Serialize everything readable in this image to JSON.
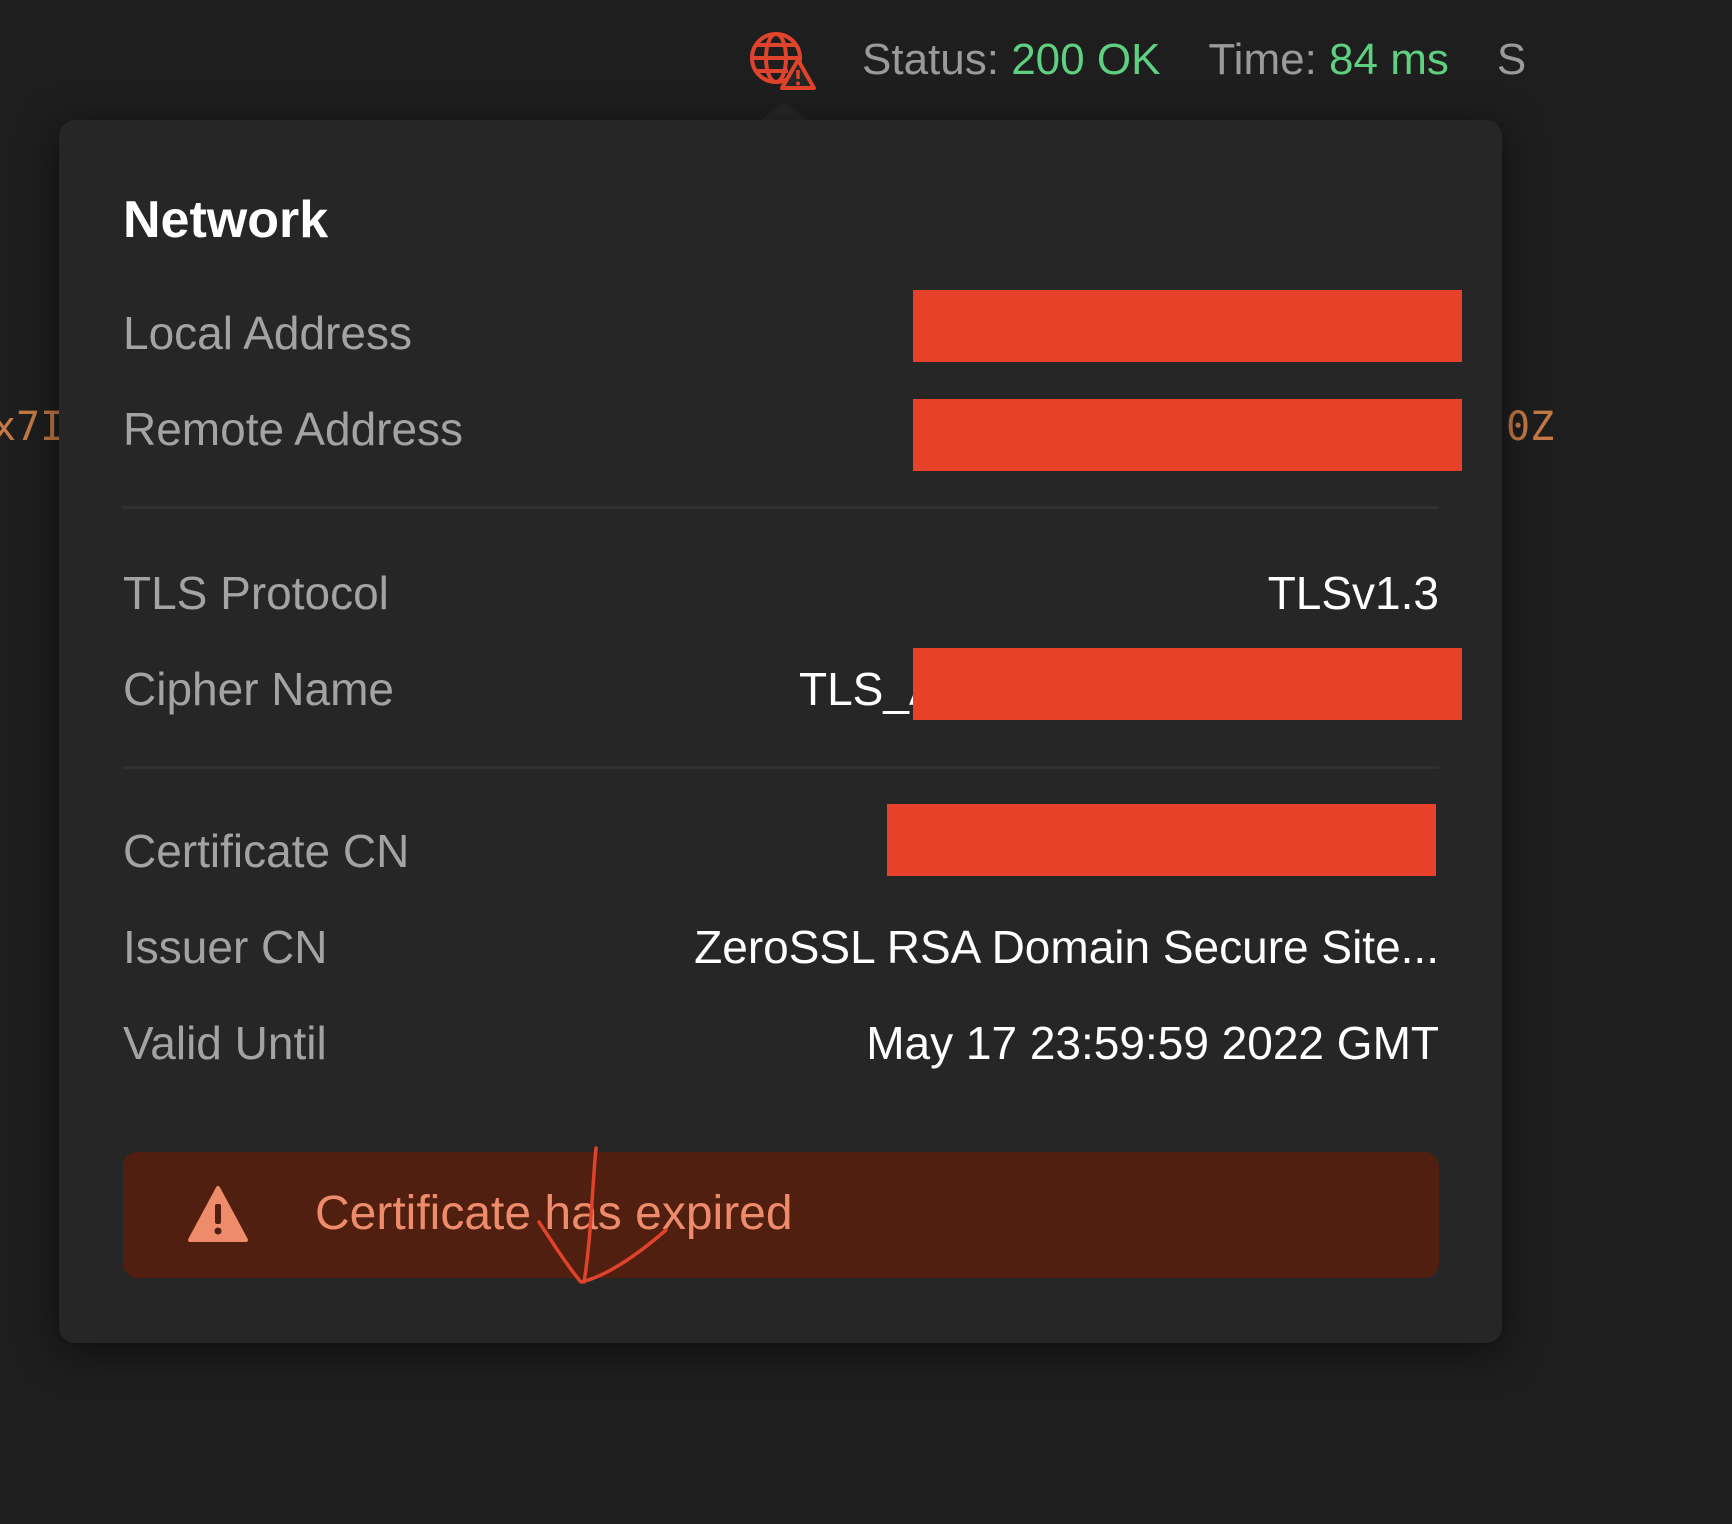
{
  "status_bar": {
    "status_label": "Status:",
    "status_value": "200 OK",
    "time_label": "Time:",
    "time_value": "84 ms",
    "truncated_label": "S",
    "ok_color": "#5fcf80",
    "globe_icon": "globe-warning-icon"
  },
  "background": {
    "code_left": "x7I",
    "code_right": "0Z"
  },
  "network": {
    "title": "Network",
    "local_address": {
      "label": "Local Address",
      "value": ""
    },
    "remote_address": {
      "label": "Remote Address",
      "value": ""
    },
    "tls_protocol": {
      "label": "TLS Protocol",
      "value": "TLSv1.3"
    },
    "cipher_name": {
      "label": "Cipher Name",
      "value": "TLS_A"
    },
    "certificate_cn": {
      "label": "Certificate CN",
      "value": ""
    },
    "issuer_cn": {
      "label": "Issuer CN",
      "value": "ZeroSSL RSA Domain Secure Site..."
    },
    "valid_until": {
      "label": "Valid Until",
      "value": "May 17 23:59:59 2022 GMT"
    }
  },
  "alert": {
    "icon": "warning-triangle-icon",
    "text": "Certificate has expired",
    "background_color": "#511f10",
    "text_color": "#ee8b6b"
  },
  "redaction_color": "#e8412a"
}
